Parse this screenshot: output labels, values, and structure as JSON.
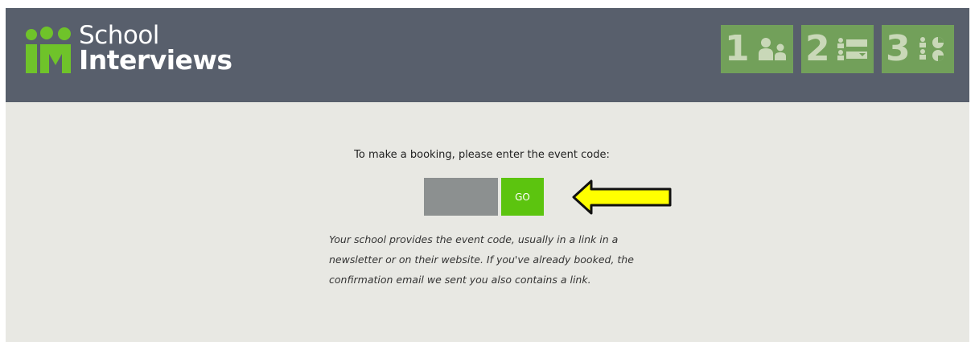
{
  "brand": {
    "name_line1": "School",
    "name_line2": "Interviews",
    "logo_icon": "im-people-logo-icon",
    "accent": "#6fc32a",
    "header_bg": "#585f6c"
  },
  "steps": [
    {
      "number": "1",
      "icon": "people-icon"
    },
    {
      "number": "2",
      "icon": "list-icon"
    },
    {
      "number": "3",
      "icon": "schedule-icon"
    }
  ],
  "booking": {
    "prompt": "To make a booking, please enter the event code:",
    "code_value": "",
    "go_label": "GO",
    "help_lines": [
      "Your school provides the event code, usually in a link in a",
      "newsletter or on their website. If you've already booked, the",
      "confirmation email we sent you also contains a link."
    ]
  },
  "colors": {
    "page_bg": "#e8e8e3",
    "input_bg": "#8c9090",
    "go_bg": "#5cc40f",
    "step_bg": "#72a05a",
    "arrow": "#ffff00"
  }
}
